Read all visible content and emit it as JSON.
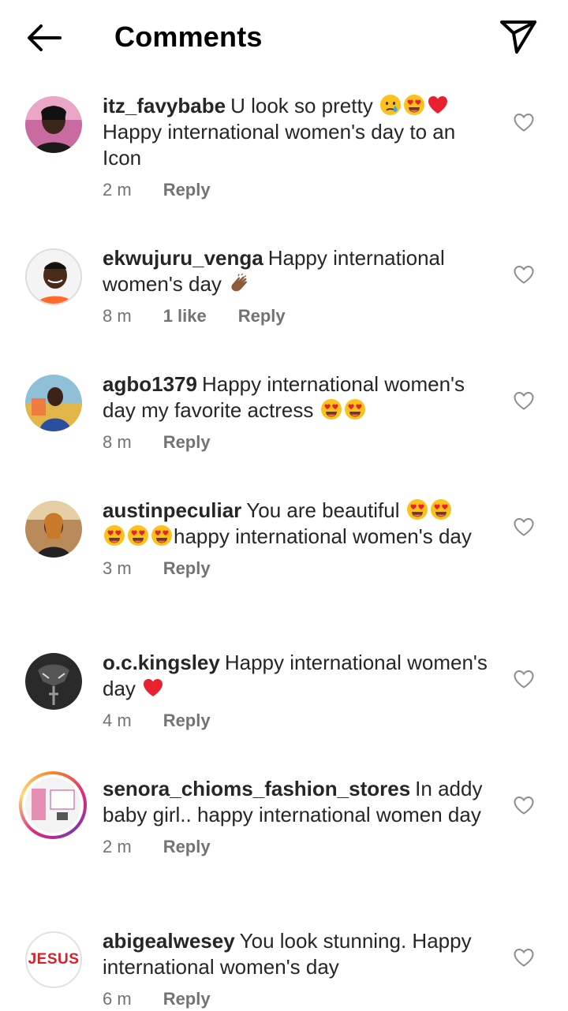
{
  "header": {
    "title": "Comments"
  },
  "comments": [
    {
      "username": "itz_favybabe",
      "line1": "U look so pretty",
      "line2": "Happy international women's day to an Icon",
      "time": "2 m",
      "reply": "Reply"
    },
    {
      "username": "ekwujuru_venga",
      "text": "Happy international women's day",
      "time": "8 m",
      "likes": "1 like",
      "reply": "Reply"
    },
    {
      "username": "agbo1379",
      "text": "Happy international women's day my favorite actress",
      "time": "8 m",
      "reply": "Reply"
    },
    {
      "username": "austinpeculiar",
      "text1": "You are beautiful",
      "text2": "happy international women's day",
      "time": "3 m",
      "reply": "Reply"
    },
    {
      "username": "o.c.kingsley",
      "text": "Happy international women's day",
      "time": "4 m",
      "reply": "Reply"
    },
    {
      "username": "senora_chioms_fashion_stores",
      "text": "In addy baby girl.. happy international women day",
      "time": "2 m",
      "reply": "Reply"
    },
    {
      "username": "abigealwesey",
      "text": "You look stunning. Happy international women's day",
      "time": "6 m",
      "reply": "Reply",
      "avatar_text": "JESUS"
    }
  ],
  "icons": {
    "back": "arrow-left-icon",
    "send": "paper-plane-icon",
    "like": "heart-outline-icon",
    "emoji_heart_eyes": "heart-eyes-emoji",
    "emoji_crying": "crying-face-emoji",
    "emoji_red_heart": "red-heart-emoji",
    "emoji_clap": "clapping-hands-emoji"
  },
  "colors": {
    "text": "#262626",
    "secondary": "#737373",
    "heart_red": "#e8202f"
  }
}
